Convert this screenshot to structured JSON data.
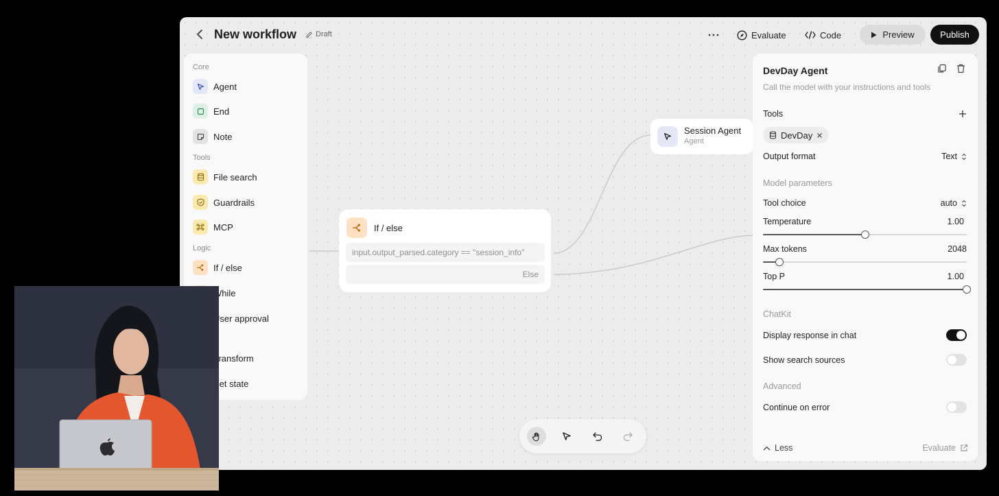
{
  "topbar": {
    "title": "New workflow",
    "status": "Draft",
    "evaluate_label": "Evaluate",
    "code_label": "Code",
    "preview_label": "Preview",
    "publish_label": "Publish"
  },
  "node_library": {
    "core_label": "Core",
    "core_items": [
      "Agent",
      "End",
      "Note"
    ],
    "tools_label": "Tools",
    "tools_items": [
      "File search",
      "Guardrails",
      "MCP"
    ],
    "logic_label": "Logic",
    "logic_items": [
      "If / else",
      "While",
      "User approval"
    ],
    "data_items": [
      "Transform",
      "Set state"
    ]
  },
  "canvas": {
    "ifelse_node": {
      "title": "If / else",
      "condition": "input.output_parsed.category == \"session_info\"",
      "else_label": "Else"
    },
    "session_node": {
      "title": "Session Agent",
      "subtitle": "Agent"
    }
  },
  "inspector": {
    "title": "DevDay Agent",
    "description": "Call the model with your instructions and tools",
    "tools_label": "Tools",
    "tool_chip": "DevDay",
    "output_format_label": "Output format",
    "output_format_value": "Text",
    "model_params_label": "Model parameters",
    "tool_choice_label": "Tool choice",
    "tool_choice_value": "auto",
    "temperature_label": "Temperature",
    "temperature_value": "1.00",
    "temperature_fraction": 0.5,
    "max_tokens_label": "Max tokens",
    "max_tokens_value": "2048",
    "max_tokens_fraction": 0.08,
    "top_p_label": "Top P",
    "top_p_value": "1.00",
    "top_p_fraction": 1.0,
    "chatkit_label": "ChatKit",
    "display_response_label": "Display response in chat",
    "display_response_on": true,
    "show_sources_label": "Show search sources",
    "show_sources_on": false,
    "advanced_label": "Advanced",
    "continue_on_error_label": "Continue on error",
    "continue_on_error_on": false,
    "less_label": "Less",
    "evaluate_label": "Evaluate"
  },
  "colors": {
    "primary_button": "#111111",
    "agent_icon_bg": "#e4e8f6",
    "logic_icon_bg": "#fde1c2",
    "tools_icon_bg": "#fbeab0"
  }
}
